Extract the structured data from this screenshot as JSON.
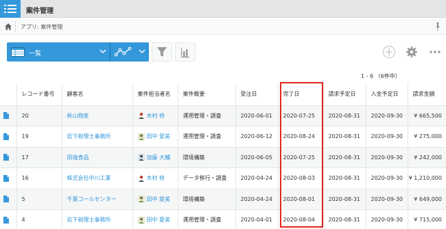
{
  "app": {
    "title": "案件管理"
  },
  "breadcrumb": {
    "text": "アプリ: 案件管理"
  },
  "toolbar": {
    "view_label": "一覧"
  },
  "pager": {
    "text": "1 - 6 （6件中）"
  },
  "table": {
    "columns": [
      "",
      "レコード番号",
      "顧客名",
      "案件担当者名",
      "案件概要",
      "受注日",
      "完了日",
      "請求予定日",
      "入金予定日",
      "請求金額"
    ],
    "rows": [
      {
        "record": "20",
        "customer": "新山物産",
        "owner": "木村 修",
        "summary": "運用管理・調査",
        "order_date": "2020-06-01",
        "done_date": "2020-07-25",
        "bill_date": "2020-08-31",
        "pay_date": "2020-09-30",
        "amount": "¥ 665,500"
      },
      {
        "record": "19",
        "customer": "岩下税理士事務所",
        "owner": "田中 愛美",
        "summary": "運用管理・調査",
        "order_date": "2020-06-12",
        "done_date": "2020-08-24",
        "bill_date": "2020-08-31",
        "pay_date": "2020-09-30",
        "amount": "¥ 275,000"
      },
      {
        "record": "17",
        "customer": "田端食品",
        "owner": "加藤 大輔",
        "summary": "環境構築",
        "order_date": "2020-06-05",
        "done_date": "2020-07-25",
        "bill_date": "2020-08-31",
        "pay_date": "2020-09-30",
        "amount": "¥ 242,000"
      },
      {
        "record": "16",
        "customer": "株式会社中川工業",
        "owner": "木村 修",
        "summary": "データ移行・調査",
        "order_date": "2020-04-24",
        "done_date": "2020-08-03",
        "bill_date": "2020-08-31",
        "pay_date": "2020-09-30",
        "amount": "¥ 1,210,000"
      },
      {
        "record": "5",
        "customer": "千葉コールセンター",
        "owner": "田中 愛美",
        "summary": "環境構築",
        "order_date": "2020-04-24",
        "done_date": "2020-08-01",
        "bill_date": "2020-08-31",
        "pay_date": "2020-09-30",
        "amount": "¥ 649,000"
      },
      {
        "record": "4",
        "customer": "岩下税理士事務所",
        "owner": "田中 愛美",
        "summary": "運用管理・調査",
        "order_date": "2020-04-01",
        "done_date": "2020-08-04",
        "bill_date": "2020-08-31",
        "pay_date": "2020-09-30",
        "amount": "¥ 715,000"
      }
    ]
  },
  "icons": {
    "menu": "hamburger-list-icon",
    "home": "home-icon",
    "pin": "pin-icon",
    "view": "list-view-icon",
    "graph": "line-graph-icon",
    "filter": "filter-funnel-icon",
    "chart": "bar-chart-icon",
    "add": "plus-icon",
    "settings": "gear-icon",
    "more": "more-options-icon",
    "record": "document-icon"
  },
  "colors": {
    "accent": "#3498db",
    "highlight": "#e2271e",
    "link": "#3498db"
  }
}
